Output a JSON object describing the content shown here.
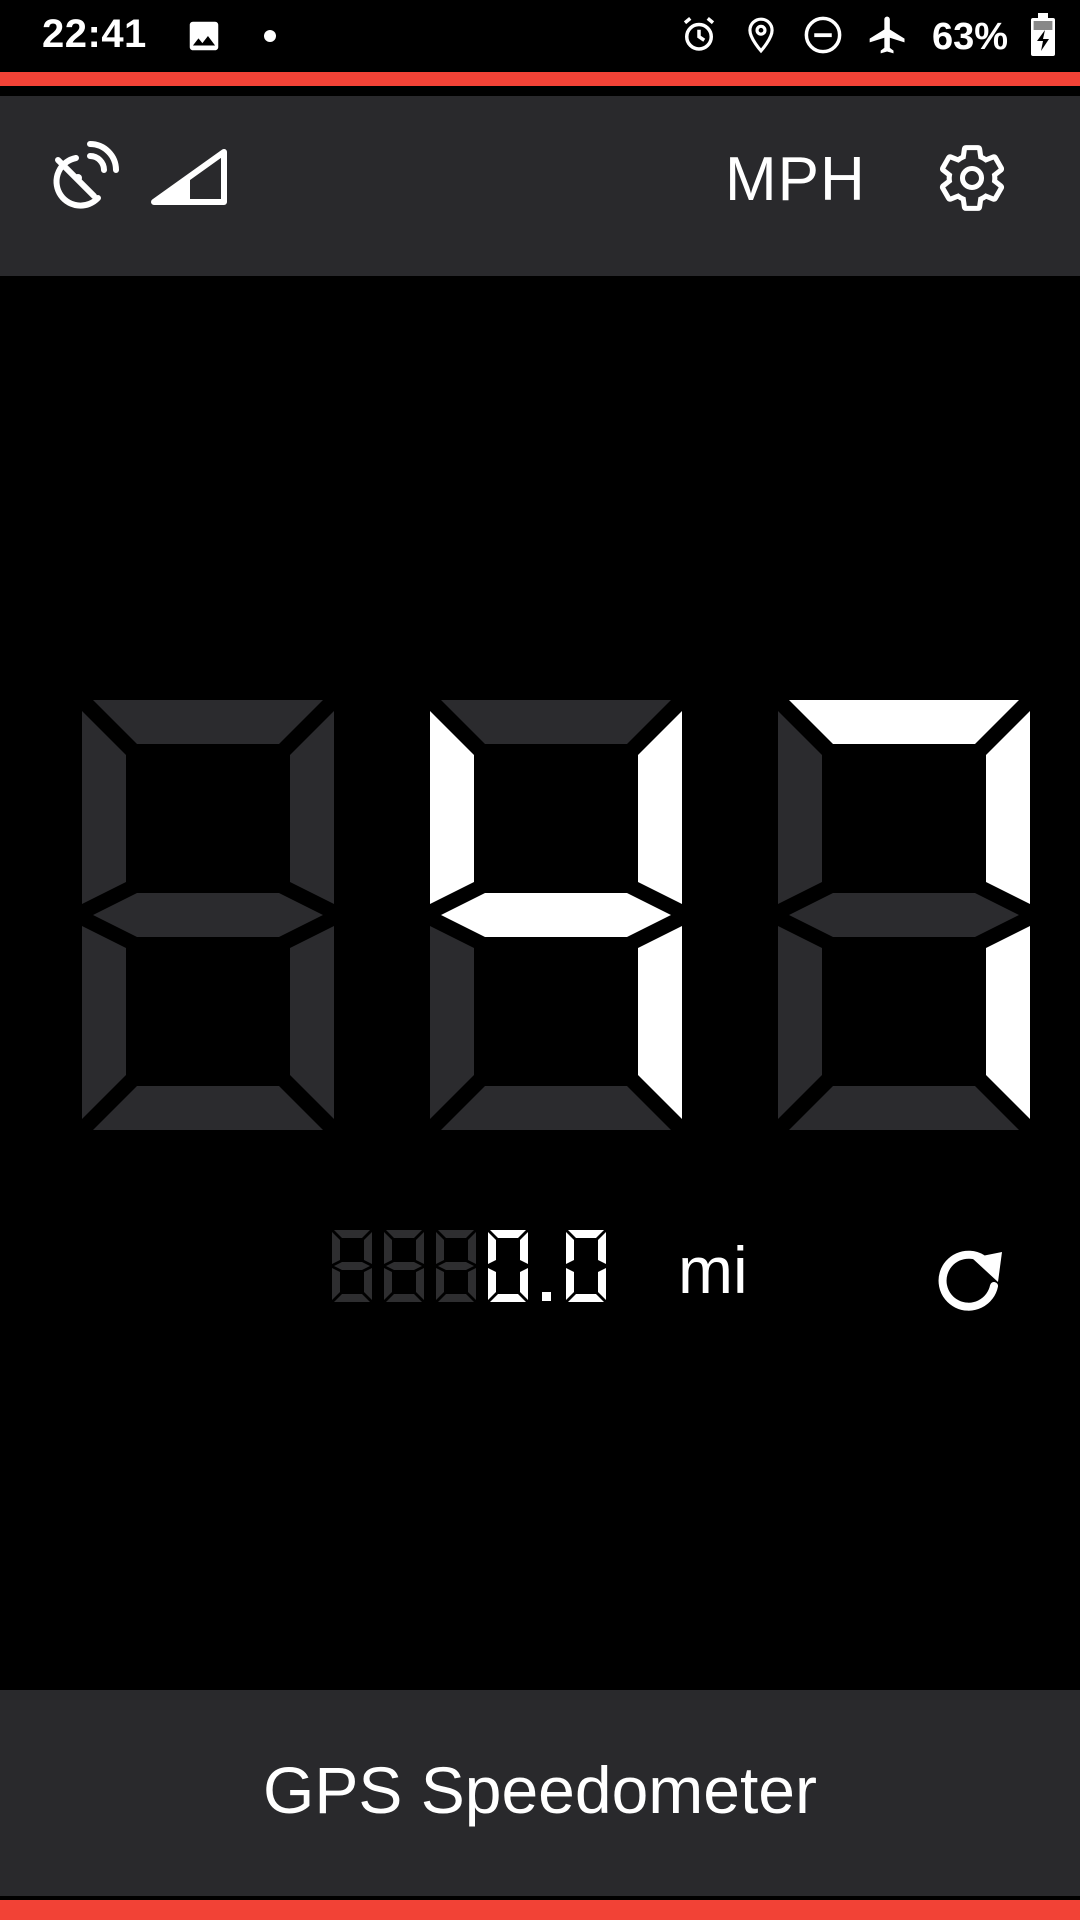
{
  "status_bar": {
    "time": "22:41",
    "battery_percent": "63%",
    "left_icons": [
      "image-icon",
      "dot-icon"
    ],
    "right_icons": [
      "alarm-icon",
      "location-icon",
      "do-not-disturb-icon",
      "airplane-icon",
      "battery-charging-icon"
    ]
  },
  "toolbar": {
    "unit": "MPH",
    "icons": [
      "gps-off-icon",
      "signal-icon",
      "settings-icon"
    ]
  },
  "speed": {
    "value": "47",
    "digits": [
      null,
      4,
      7
    ],
    "active_color": "#ffffff",
    "inactive_color": "#2b2b2e"
  },
  "odometer": {
    "value": "0.0",
    "inactive_digits": 3,
    "unit": "mi"
  },
  "footer": {
    "app_name": "GPS Speedometer"
  },
  "colors": {
    "accent": "#f24236",
    "bar_background": "#29292c",
    "background": "#000000"
  }
}
